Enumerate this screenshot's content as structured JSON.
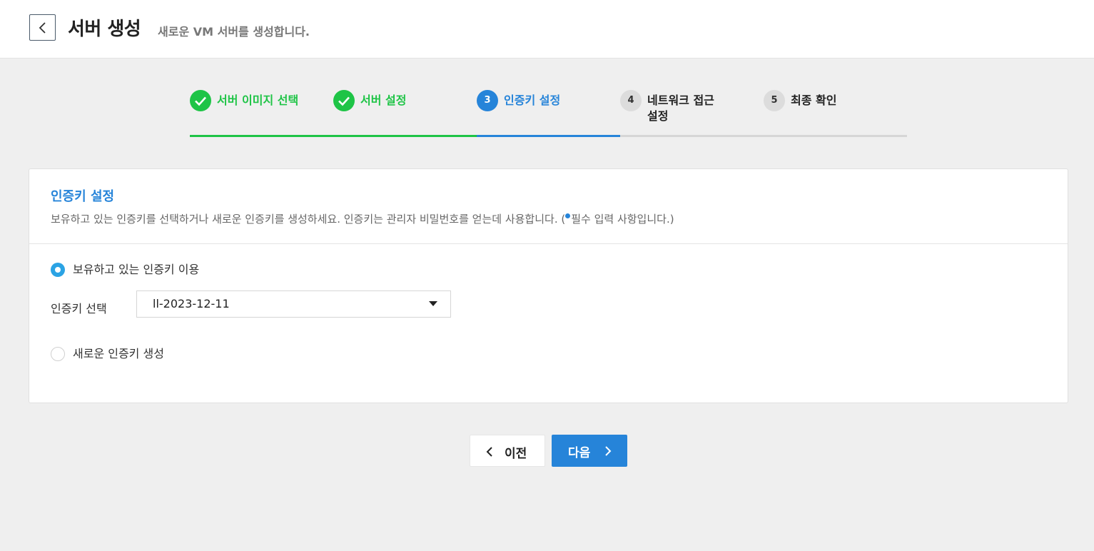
{
  "header": {
    "title": "서버 생성",
    "subtitle": "새로운 VM 서버를 생성합니다."
  },
  "stepper": {
    "steps": [
      {
        "number": "1",
        "label": "서버 이미지 선택",
        "state": "done"
      },
      {
        "number": "2",
        "label": "서버 설정",
        "state": "done"
      },
      {
        "number": "3",
        "label": "인증키 설정",
        "state": "active"
      },
      {
        "number": "4",
        "label": "네트워크 접근 설정",
        "state": "todo"
      },
      {
        "number": "5",
        "label": "최종 확인",
        "state": "todo"
      }
    ]
  },
  "card": {
    "title": "인증키 설정",
    "description_main": "보유하고 있는 인증키를 선택하거나 새로운 인증키를 생성하세요. 인증키는 관리자 비밀번호를 얻는데 사용합니다. (",
    "description_required": "필수 입력 사항입니다.)",
    "options": {
      "existing_label": "보유하고 있는 인증키 이용",
      "new_label": "새로운 인증키 생성",
      "selected": "existing"
    },
    "key_select": {
      "label": "인증키 선택",
      "value": "ll-2023-12-11"
    }
  },
  "footer": {
    "prev_label": "이전",
    "next_label": "다음"
  },
  "colors": {
    "accent": "#2684d9",
    "done": "#1ec446",
    "radio": "#2ba3e4",
    "background": "#efefef"
  }
}
